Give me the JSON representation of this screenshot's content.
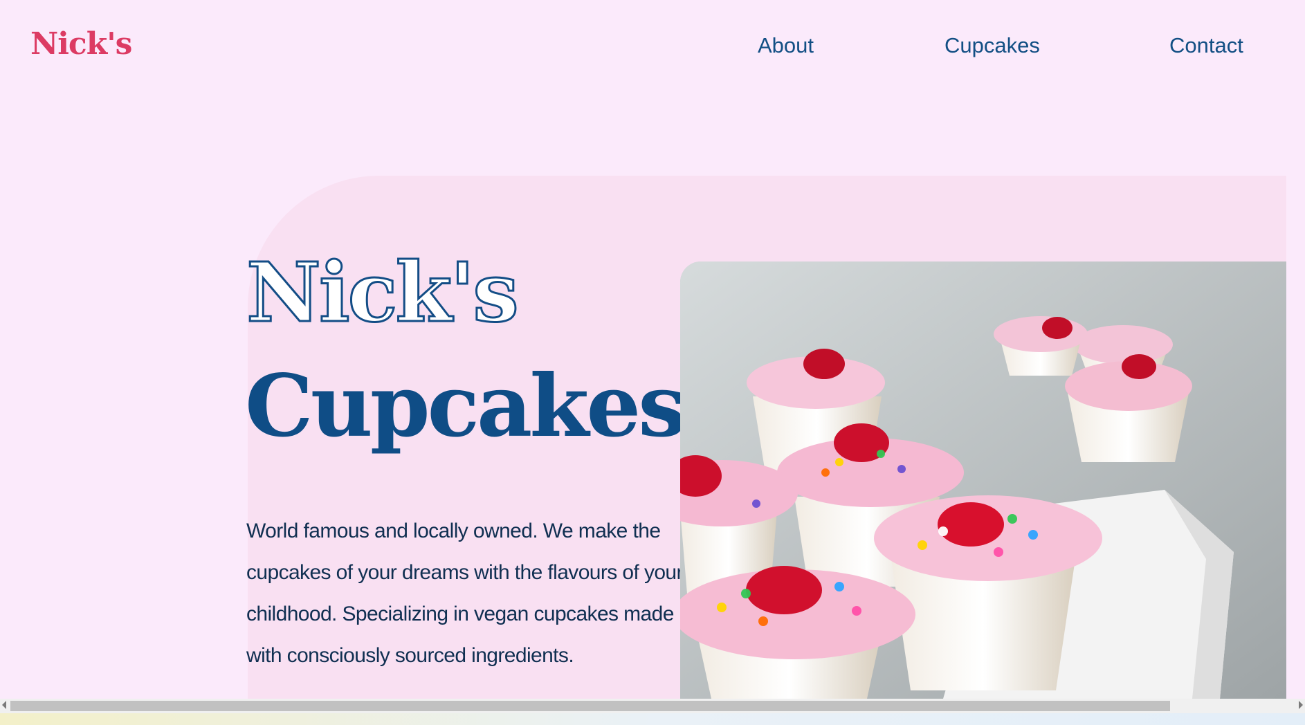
{
  "header": {
    "logo": "Nick's",
    "nav": [
      {
        "label": "About"
      },
      {
        "label": "Cupcakes"
      },
      {
        "label": "Contact"
      }
    ]
  },
  "hero": {
    "title_outline": "Nick's",
    "title_solid": "Cupcakes",
    "description": "World famous and locally owned. We make the cupcakes of your dreams with the flavours of your childhood. Specializing in vegan cupcakes made with consciously sourced ingredients.",
    "image_alt": "Pink frosted cupcakes with sprinkles and cherries on a white plate"
  },
  "colors": {
    "background": "#fbeafb",
    "panel": "#f9e0f2",
    "logo": "#dc3b63",
    "nav": "#124f84",
    "title": "#0f4d86",
    "text": "#102f51"
  }
}
